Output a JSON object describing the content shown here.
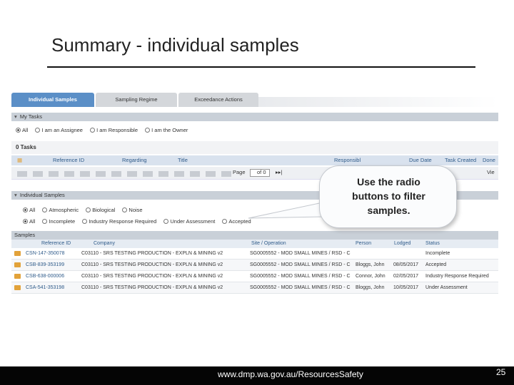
{
  "slide": {
    "title": "Summary - individual samples",
    "footer_url": "www.dmp.wa.gov.au/ResourcesSafety",
    "page_number": "25"
  },
  "tabs": [
    "Individual Samples",
    "Sampling Regime",
    "Exceedance Actions"
  ],
  "my_tasks": {
    "heading": "My Tasks",
    "filters": [
      "All",
      "I am an Assignee",
      "I am Responsible",
      "I am the Owner"
    ],
    "count_label": "0 Tasks",
    "columns": [
      "Reference ID",
      "Regarding",
      "Title",
      "Responsibl",
      "Due Date",
      "Task Created",
      "Done"
    ],
    "pager_label": "Page",
    "pager_of": "of 0",
    "view_label": "Vie"
  },
  "individual_samples": {
    "heading": "Individual Samples",
    "type_filters": [
      "All",
      "Atmospheric",
      "Biological",
      "Noise"
    ],
    "status_filters": [
      "All",
      "Incomplete",
      "Industry Response Required",
      "Under Assessment",
      "Accepted"
    ]
  },
  "samples": {
    "heading": "Samples",
    "columns": [
      "Reference ID",
      "Company",
      "Site / Operation",
      "Person",
      "Lodged",
      "Status"
    ],
    "rows": [
      {
        "ref": "CSN-147-350078",
        "company": "C03110 - SRS TESTING PRODUCTION - EXPLN & MINING v2",
        "site": "SG0005552 - MOD SMALL MINES / RSD - C",
        "person": "",
        "lodged": "",
        "status": "Incomplete"
      },
      {
        "ref": "CSB-839-353199",
        "company": "C03110 - SRS TESTING PRODUCTION - EXPLN & MINING v2",
        "site": "SG0005552 - MOD SMALL MINES / RSD - C",
        "person": "Bloggs, John",
        "lodged": "08/05/2017",
        "status": "Accepted"
      },
      {
        "ref": "CSB-638-000006",
        "company": "C03110 - SRS TESTING PRODUCTION - EXPLN & MINING v2",
        "site": "SG0005552 - MOD SMALL MINES / RSD - C",
        "person": "Connor, John",
        "lodged": "02/05/2017",
        "status": "Industry Response Required"
      },
      {
        "ref": "CSA-541-353198",
        "company": "C03110 - SRS TESTING PRODUCTION - EXPLN & MINING v2",
        "site": "SG0005552 - MOD SMALL MINES / RSD - C",
        "person": "Bloggs, John",
        "lodged": "10/05/2017",
        "status": "Under Assessment"
      }
    ]
  },
  "callout": {
    "lines": [
      "Use the radio",
      "buttons to filter",
      "samples."
    ]
  },
  "icons": {
    "row_icon": "folder-icon",
    "collapse_icon": "triangle-down-icon"
  },
  "colors": {
    "tab_active": "#5b8fc7",
    "header_bar": "#c9d0d8",
    "link": "#2f5b8a",
    "footer": "#050505"
  }
}
